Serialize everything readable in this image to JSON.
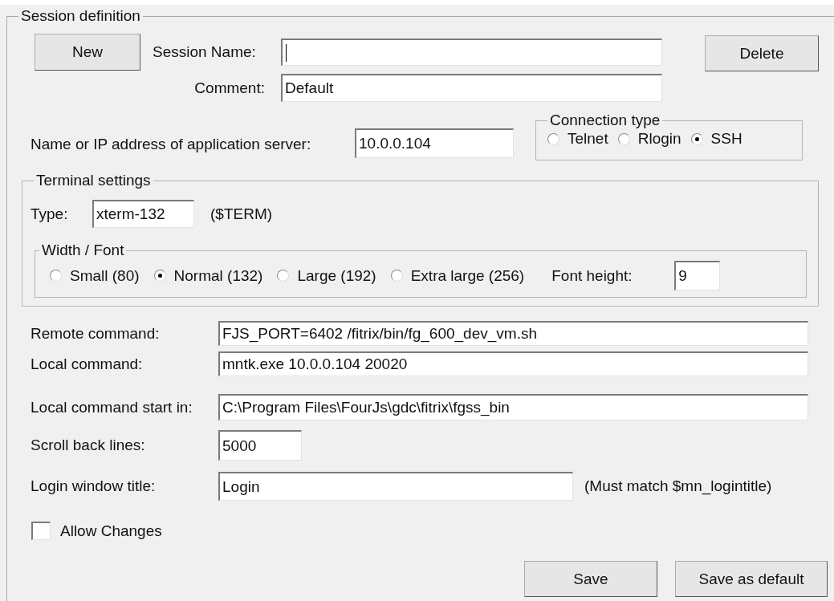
{
  "group": {
    "title": "Session definition"
  },
  "new_button": "New",
  "session_name": {
    "label": "Session Name:",
    "focused": true
  },
  "delete_button": "Delete",
  "comment": {
    "label": "Comment:",
    "value": "Default"
  },
  "server": {
    "label": "Name or IP address of application server:",
    "value": "10.0.0.104"
  },
  "connection_type": {
    "title": "Connection type",
    "options": [
      {
        "label": "Telnet",
        "selected": false
      },
      {
        "label": "Rlogin",
        "selected": false
      },
      {
        "label": "SSH",
        "selected": true
      }
    ]
  },
  "terminal_settings": {
    "title": "Terminal settings",
    "type": {
      "label": "Type:",
      "value": "xterm-132",
      "note": "($TERM)"
    },
    "width_font": {
      "title": "Width / Font",
      "options": [
        {
          "label": "Small (80)",
          "selected": false
        },
        {
          "label": "Normal (132)",
          "selected": true
        },
        {
          "label": "Large (192)",
          "selected": false
        },
        {
          "label": "Extra large (256)",
          "selected": false
        }
      ],
      "font_height": {
        "label": "Font height:",
        "value": "9"
      }
    }
  },
  "fields": [
    {
      "label": "Remote command:",
      "value": "FJS_PORT=6402 /fitrix/bin/fg_600_dev_vm.sh"
    },
    {
      "label": "Local command:",
      "value": "mntk.exe 10.0.0.104 20020"
    },
    {
      "label": "Local command start in:",
      "value": "C:\\Program Files\\FourJs\\gdc\\fitrix\\fgss_bin"
    },
    {
      "label": "Scroll back lines:",
      "value": "5000"
    },
    {
      "label": "Login window title:",
      "value": "Login",
      "note": "(Must match $mn_logintitle)"
    }
  ],
  "allow_changes": {
    "label": "Allow Changes",
    "checked": false
  },
  "buttons": [
    "Save",
    "Save as default"
  ]
}
